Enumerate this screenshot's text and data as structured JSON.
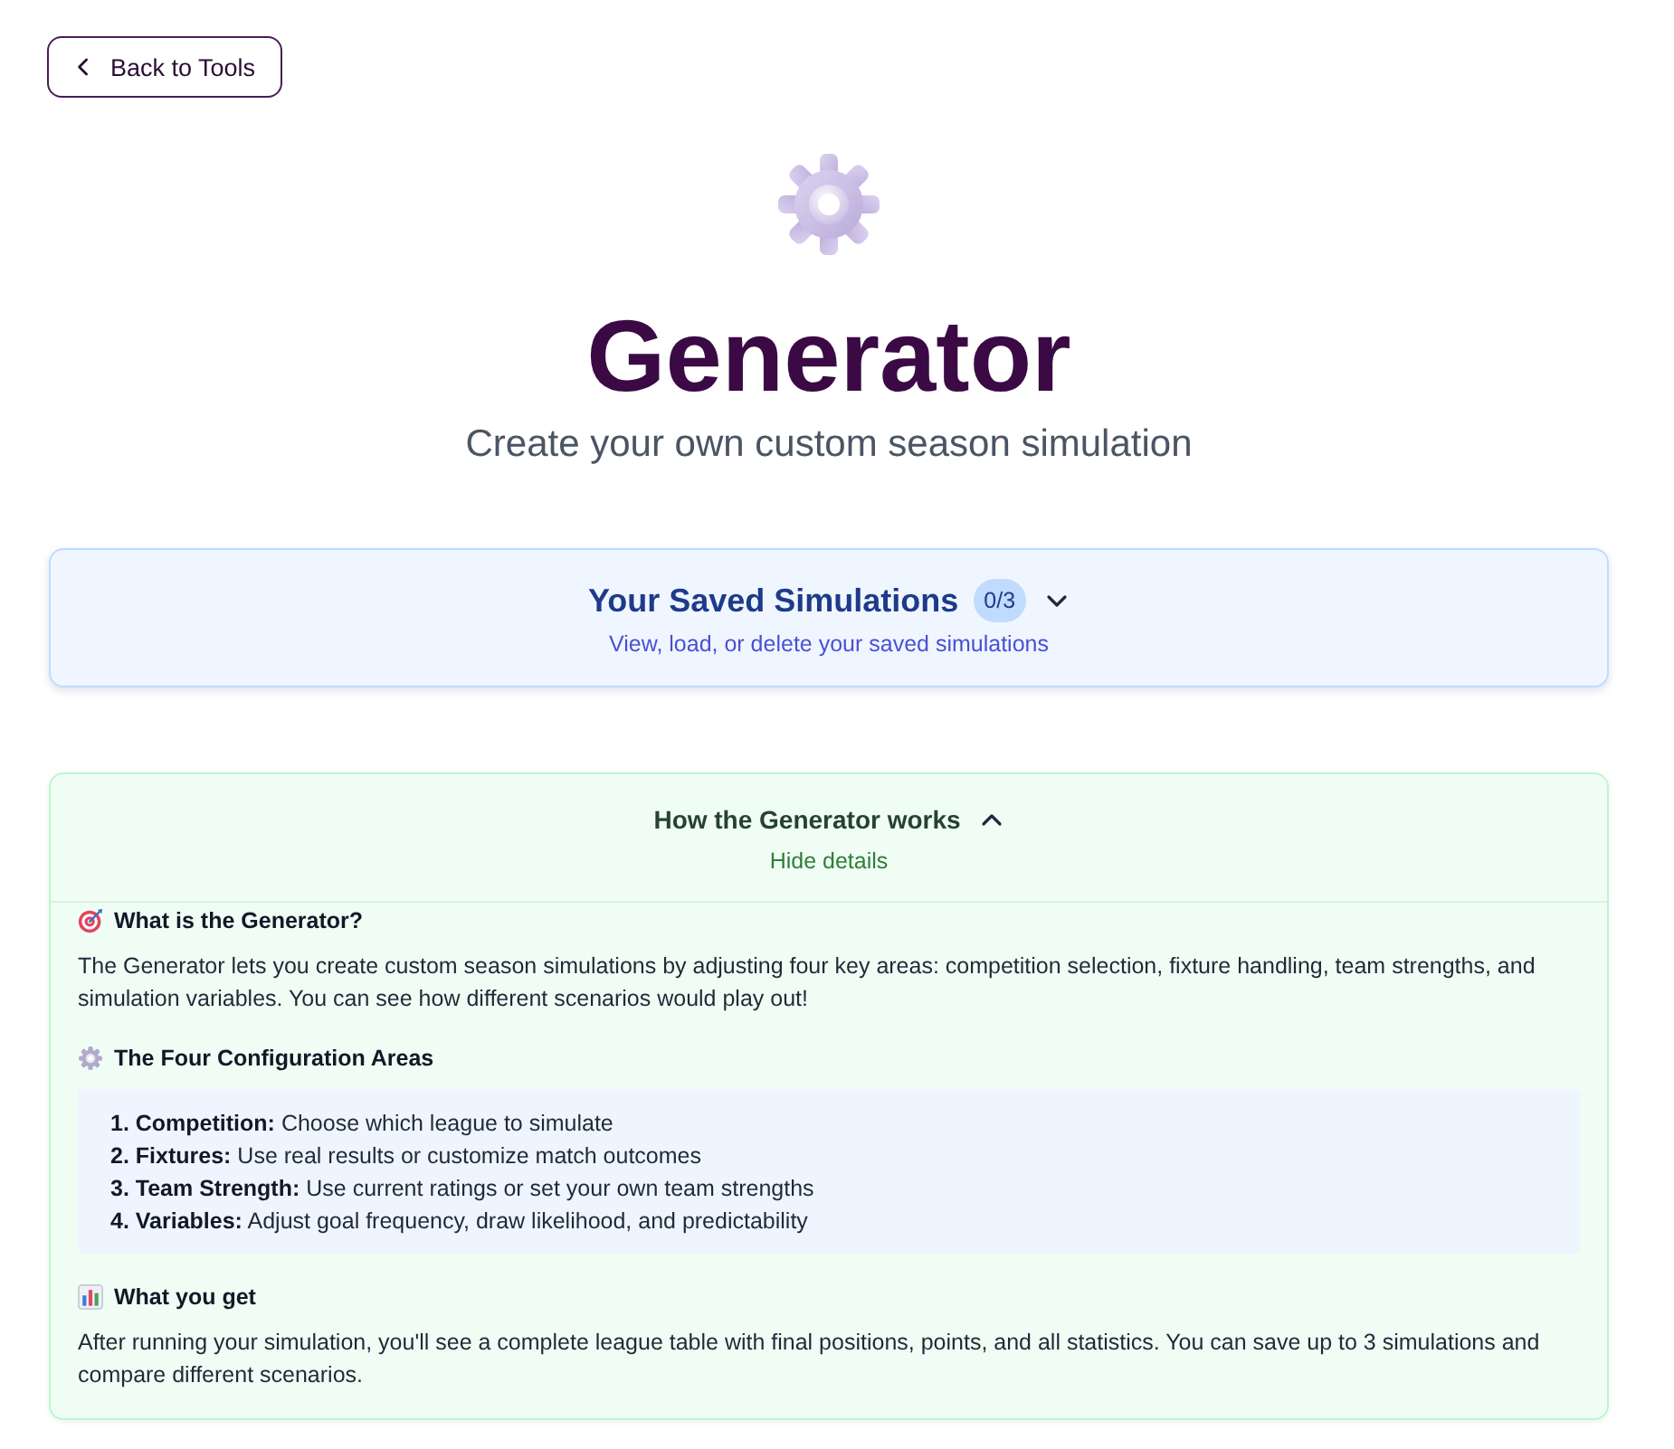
{
  "back_button": {
    "label": "Back to Tools"
  },
  "header": {
    "title": "Generator",
    "subtitle": "Create your own custom season simulation"
  },
  "saved_simulations": {
    "title": "Your Saved Simulations",
    "count": "0/3",
    "expanded": false,
    "subtitle": "View, load, or delete your saved simulations"
  },
  "how_it_works": {
    "title": "How the Generator works",
    "expanded": true,
    "toggle_label": "Hide details",
    "sections": [
      {
        "kind": "paragraph",
        "heading": "What is the Generator?",
        "text": "The Generator lets you create custom season simulations by adjusting four key areas: competition selection, fixture handling, team strengths, and simulation variables. You can see how different scenarios would play out!"
      },
      {
        "kind": "list",
        "heading": "The Four Configuration Areas",
        "items": [
          "**1. Competition:** Choose which league to simulate",
          "**2. Fixtures:** Use real results or customize match outcomes",
          "**3. Team Strength:** Use current ratings or set your own team strengths",
          "**4. Variables:** Adjust goal frequency, draw likelihood, and predictability"
        ]
      },
      {
        "kind": "paragraph",
        "heading": "What you get",
        "text": "After running your simulation, you'll see a complete league table with final positions, points, and all statistics. You can save up to 3 simulations and compare different scenarios."
      }
    ]
  }
}
